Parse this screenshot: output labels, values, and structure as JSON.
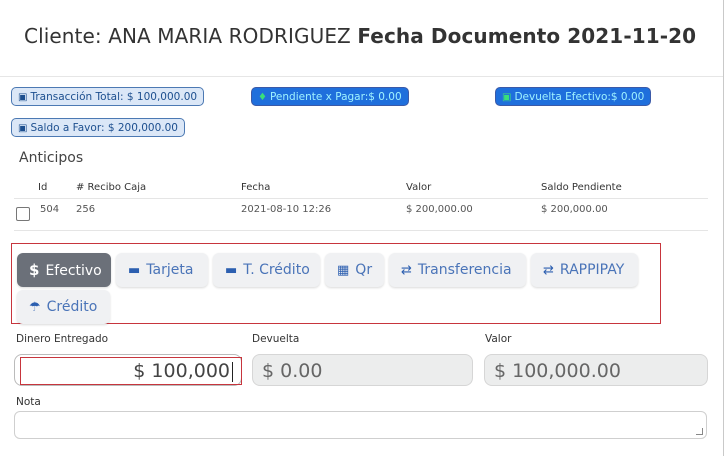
{
  "header": {
    "client_prefix": "Cliente: ANA MARIA RODRIGUEZ",
    "date_label": "Fecha Documento 2021-11-20"
  },
  "badges": [
    {
      "icon": "money-icon",
      "glyph": "▣",
      "text": "Transacción Total: $ 100,000.00"
    },
    {
      "icon": "diamond-icon",
      "glyph": "♦",
      "text": "Pendiente x Pagar:$ 0.00"
    },
    {
      "icon": "money-icon",
      "glyph": "▣",
      "text": "Devuelta Efectivo:$ 0.00"
    },
    {
      "icon": "money-icon",
      "glyph": "▣",
      "text": "Saldo a Favor: $ 200,000.00"
    }
  ],
  "anticipos": {
    "title": "Anticipos",
    "columns": [
      "Id",
      "# Recibo Caja",
      "Fecha",
      "Valor",
      "Saldo Pendiente"
    ],
    "rows": [
      {
        "id": "504",
        "recibo": "256",
        "fecha": "2021-08-10 12:26",
        "valor": "$ 200,000.00",
        "saldo": "$ 200,000.00",
        "checked": false
      }
    ]
  },
  "payment_methods": [
    {
      "label": "Efectivo",
      "glyph": "$",
      "icon": "dollar-icon",
      "active": true
    },
    {
      "label": "Tarjeta",
      "glyph": "▬",
      "icon": "card-icon",
      "active": false
    },
    {
      "label": "T. Crédito",
      "glyph": "▬",
      "icon": "credit-card-icon",
      "active": false
    },
    {
      "label": "Qr",
      "glyph": "▦",
      "icon": "qr-icon",
      "active": false
    },
    {
      "label": "Transferencia",
      "glyph": "⇄",
      "icon": "transfer-icon",
      "active": false
    },
    {
      "label": "RAPPIPAY",
      "glyph": "⇄",
      "icon": "transfer-icon",
      "active": false
    },
    {
      "label": "Crédito",
      "glyph": "☂",
      "icon": "piggy-bank-icon",
      "active": false
    }
  ],
  "fields": {
    "dinero_label": "Dinero Entregado",
    "dinero_value": "$ 100,000",
    "devuelta_label": "Devuelta",
    "devuelta_value": "$ 0.00",
    "valor_label": "Valor",
    "valor_value": "$ 100,000.00"
  },
  "nota": {
    "label": "Nota",
    "value": ""
  },
  "colors": {
    "accent_blue": "#1f6fdc",
    "active_tab": "#6b7079",
    "highlight_red": "#c7353d"
  }
}
